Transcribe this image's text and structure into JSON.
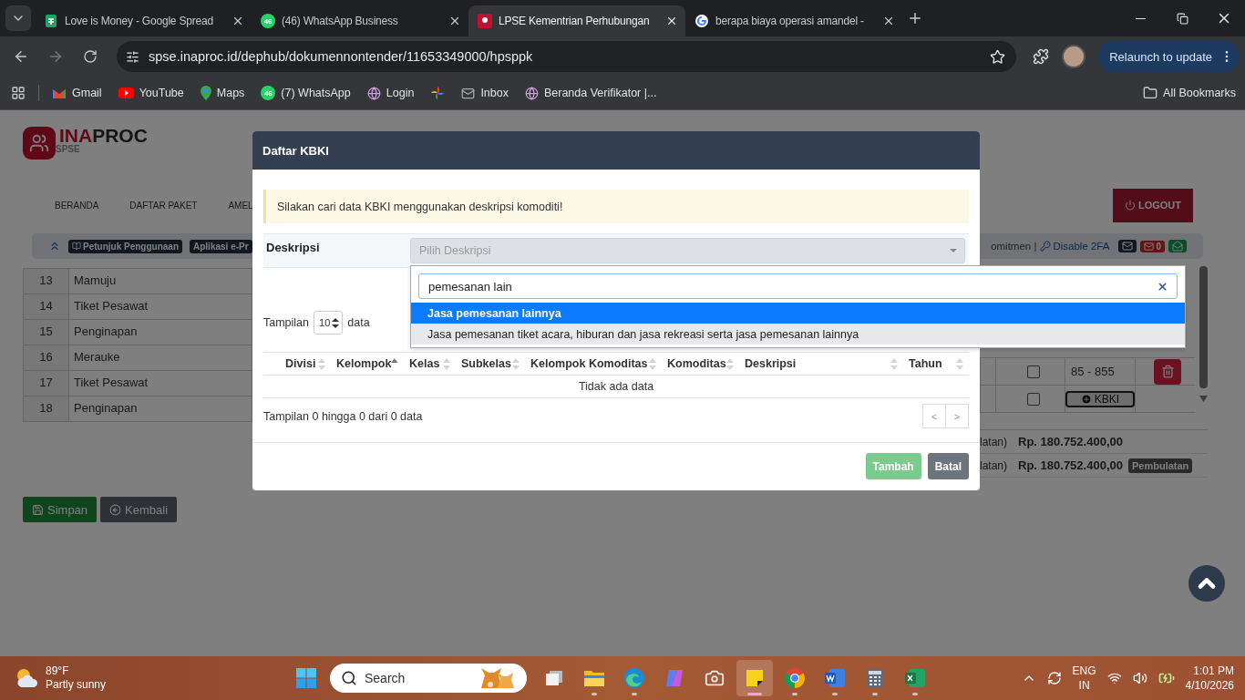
{
  "browser": {
    "tabs": [
      {
        "title": "Love is Money - Google Spread",
        "kind": "sheets",
        "selected": false
      },
      {
        "title": "(46) WhatsApp Business",
        "kind": "whatsapp",
        "badge": "46",
        "selected": false
      },
      {
        "title": "LPSE Kementrian Perhubungan",
        "kind": "inaproc",
        "selected": true
      },
      {
        "title": "berapa biaya operasi amandel -",
        "kind": "google",
        "selected": false
      }
    ],
    "address": "spse.inaproc.id/dephub/dokumennontender/11653349000/hpsppk",
    "relaunch": "Relaunch to update",
    "bookmarks": [
      {
        "label": "Gmail",
        "kind": "gmail"
      },
      {
        "label": "YouTube",
        "kind": "youtube"
      },
      {
        "label": "Maps",
        "kind": "maps"
      },
      {
        "label": "(7) WhatsApp",
        "kind": "whatsapp",
        "badge": "46"
      },
      {
        "label": "Login",
        "kind": "globe"
      },
      {
        "kind": "photos"
      },
      {
        "label": "Inbox",
        "kind": "mail"
      },
      {
        "label": "Beranda Verifikator |...",
        "kind": "globe"
      }
    ],
    "all_bookmarks": "All Bookmarks"
  },
  "page": {
    "logo": {
      "part_1": "INA",
      "part_2": "PROC",
      "subtitle": "SPSE"
    },
    "nav": [
      "BERANDA",
      "DAFTAR PAKET",
      "AMEL"
    ],
    "logout": "LOGOUT",
    "toolbar": {
      "badges": [
        "Petunjuk Penggunaan",
        "Aplikasi e-Pr"
      ],
      "cut_text": "omitmen |",
      "link": "Disable 2FA",
      "mail_count": "0"
    },
    "left_rows": [
      {
        "no": "13",
        "name": "Mamuju"
      },
      {
        "no": "14",
        "name": "Tiket Pesawat"
      },
      {
        "no": "15",
        "name": "Penginapan"
      },
      {
        "no": "16",
        "name": "Merauke"
      },
      {
        "no": "17",
        "name": "Tiket Pesawat"
      },
      {
        "no": "18",
        "name": "Penginapan"
      }
    ],
    "right_rows": [
      {
        "kind": "code",
        "checked": false,
        "code": "85 - 855"
      },
      {
        "kind": "kbki",
        "checked": false,
        "button": "KBKI"
      }
    ],
    "totals": [
      {
        "label": "latan)",
        "amount": "Rp. 180.752.400,00"
      },
      {
        "label": "latan)",
        "amount": "Rp. 180.752.400,00",
        "badge": "Pembulatan"
      }
    ],
    "save": "Simpan",
    "back": "Kembali"
  },
  "modal": {
    "title": "Daftar KBKI",
    "alert": "Silakan cari data KBKI menggunakan deskripsi komoditi!",
    "field_label": "Deskripsi",
    "select_placeholder": "Pilih Deskripsi",
    "length": {
      "before": "Tampilan",
      "value": "10",
      "after": "data"
    },
    "columns": [
      {
        "label": "Divisi",
        "sorted": false
      },
      {
        "label": "Kelompok",
        "sorted": true
      },
      {
        "label": "Kelas",
        "sorted": false
      },
      {
        "label": "Subkelas",
        "sorted": false
      },
      {
        "label": "Kelompok Komoditas",
        "sorted": false
      },
      {
        "label": "Komoditas",
        "sorted": false
      },
      {
        "label": "Deskripsi",
        "sorted": false
      },
      {
        "label": "Tahun",
        "sorted": false
      }
    ],
    "empty": "Tidak ada data",
    "info": "Tampilan 0 hingga 0 dari 0 data",
    "pagination": [
      {
        "label": "<",
        "disabled": true
      },
      {
        "label": ">",
        "disabled": true
      }
    ],
    "buttons": [
      {
        "label": "Tambah",
        "kind": "primary",
        "disabled": true
      },
      {
        "label": "Batal",
        "kind": "secondary",
        "disabled": false
      }
    ],
    "dropdown": {
      "value": "pemesanan lain",
      "options": [
        {
          "label": "Jasa pemesanan lainnya",
          "selected": true,
          "hovered": false
        },
        {
          "label": "Jasa pemesanan tiket acara, hiburan dan jasa rekreasi serta jasa pemesanan lainnya",
          "selected": false,
          "hovered": true
        }
      ]
    }
  },
  "taskbar": {
    "weather": {
      "temp": "89°F",
      "text": "Partly sunny"
    },
    "search": "Search",
    "apps": [
      {
        "kind": "taskview",
        "active": false,
        "running": false
      },
      {
        "kind": "explorer",
        "active": false,
        "running": true
      },
      {
        "kind": "edge",
        "active": false,
        "running": true
      },
      {
        "kind": "copilot",
        "active": false,
        "running": false
      },
      {
        "kind": "camera",
        "active": false,
        "running": false
      },
      {
        "kind": "sticky",
        "active": true,
        "running": true
      },
      {
        "kind": "chrome",
        "active": false,
        "running": true
      },
      {
        "kind": "word",
        "active": false,
        "running": true
      },
      {
        "kind": "calculator",
        "active": false,
        "running": true
      },
      {
        "kind": "excel",
        "active": false,
        "running": true
      }
    ],
    "lang": "ENG",
    "region": "IN",
    "time": "1:01 PM",
    "date": "4/10/2026"
  }
}
